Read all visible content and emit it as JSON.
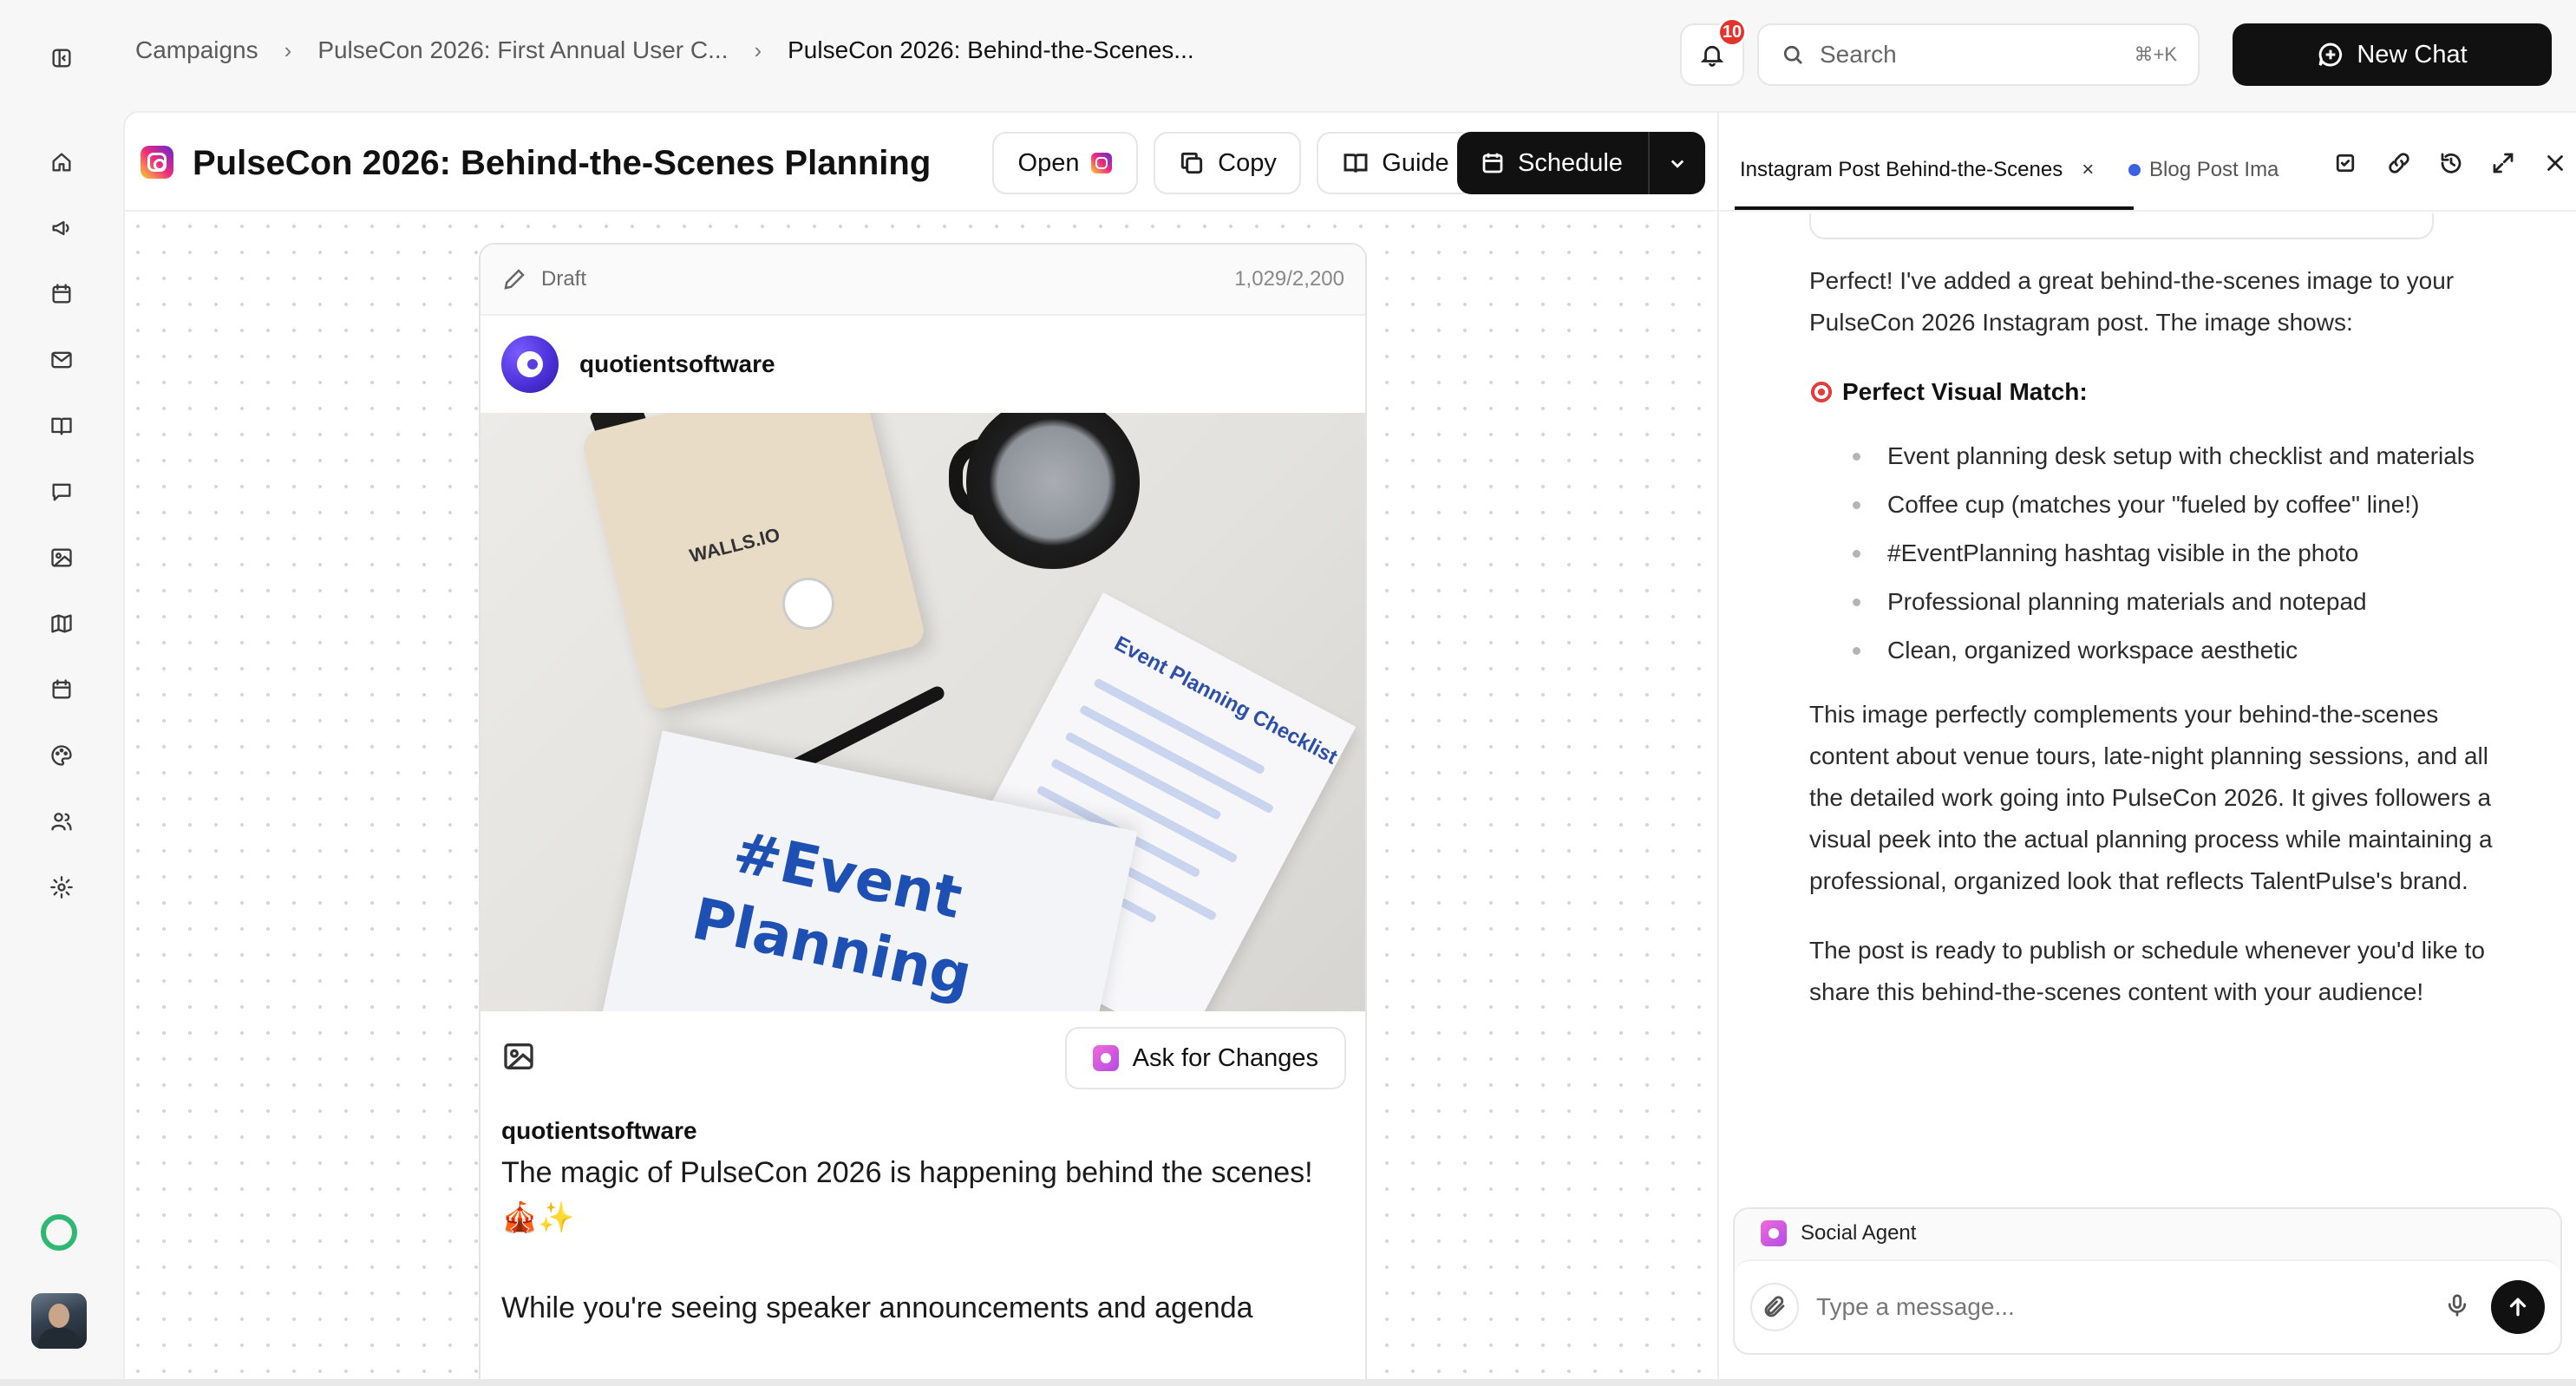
{
  "sidebar": {
    "icons": [
      "sidebar-toggle-icon",
      "home-icon",
      "megaphone-icon",
      "calendar-icon",
      "mail-icon",
      "book-icon",
      "chat-icon",
      "image-icon",
      "map-icon",
      "schedule-icon",
      "palette-icon",
      "users-icon",
      "gear-icon"
    ],
    "status_color": "#2eb872"
  },
  "header": {
    "breadcrumbs": [
      "Campaigns",
      "PulseCon 2026: First Annual User C...",
      "PulseCon 2026: Behind-the-Scenes..."
    ],
    "notifications_count": "10",
    "search_placeholder": "Search",
    "search_shortcut": "⌘+K",
    "new_chat_label": "New Chat"
  },
  "doc": {
    "title": "PulseCon 2026: Behind-the-Scenes Planning",
    "open_label": "Open",
    "copy_label": "Copy",
    "guide_label": "Guide",
    "schedule_label": "Schedule"
  },
  "post": {
    "status": "Draft",
    "char_count": "1,029/2,200",
    "account": "quotientsoftware",
    "image_text_1": "#Event",
    "image_text_2": "Planning",
    "checklist_title": "Event Planning Checklist",
    "bag_brand": "WALLS.IO",
    "ask_label": "Ask for Changes",
    "caption_user": "quotientsoftware",
    "caption_line1": "The magic of PulseCon 2026 is happening behind the scenes!",
    "caption_line2": "🎪✨",
    "caption_line3": "While you're seeing speaker announcements and agenda"
  },
  "chat": {
    "tab_active": "Instagram Post Behind-the-Scenes",
    "tab_close": "×",
    "tab_other": "Blog Post Ima",
    "intro": "Perfect! I've added a great behind-the-scenes image to your PulseCon 2026 Instagram post. The image shows:",
    "heading": "Perfect Visual Match:",
    "bullets": [
      "Event planning desk setup with checklist and materials",
      "Coffee cup (matches your \"fueled by coffee\" line!)",
      "#EventPlanning hashtag visible in the photo",
      "Professional planning materials and notepad",
      "Clean, organized workspace aesthetic"
    ],
    "para2": "This image perfectly complements your behind-the-scenes content about venue tours, late-night planning sessions, and all the detailed work going into PulseCon 2026. It gives followers a visual peek into the actual planning process while maintaining a professional, organized look that reflects TalentPulse's brand.",
    "para3": "The post is ready to publish or schedule whenever you'd like to share this behind-the-scenes content with your audience!",
    "agent_name": "Social Agent",
    "input_placeholder": "Type a message..."
  }
}
